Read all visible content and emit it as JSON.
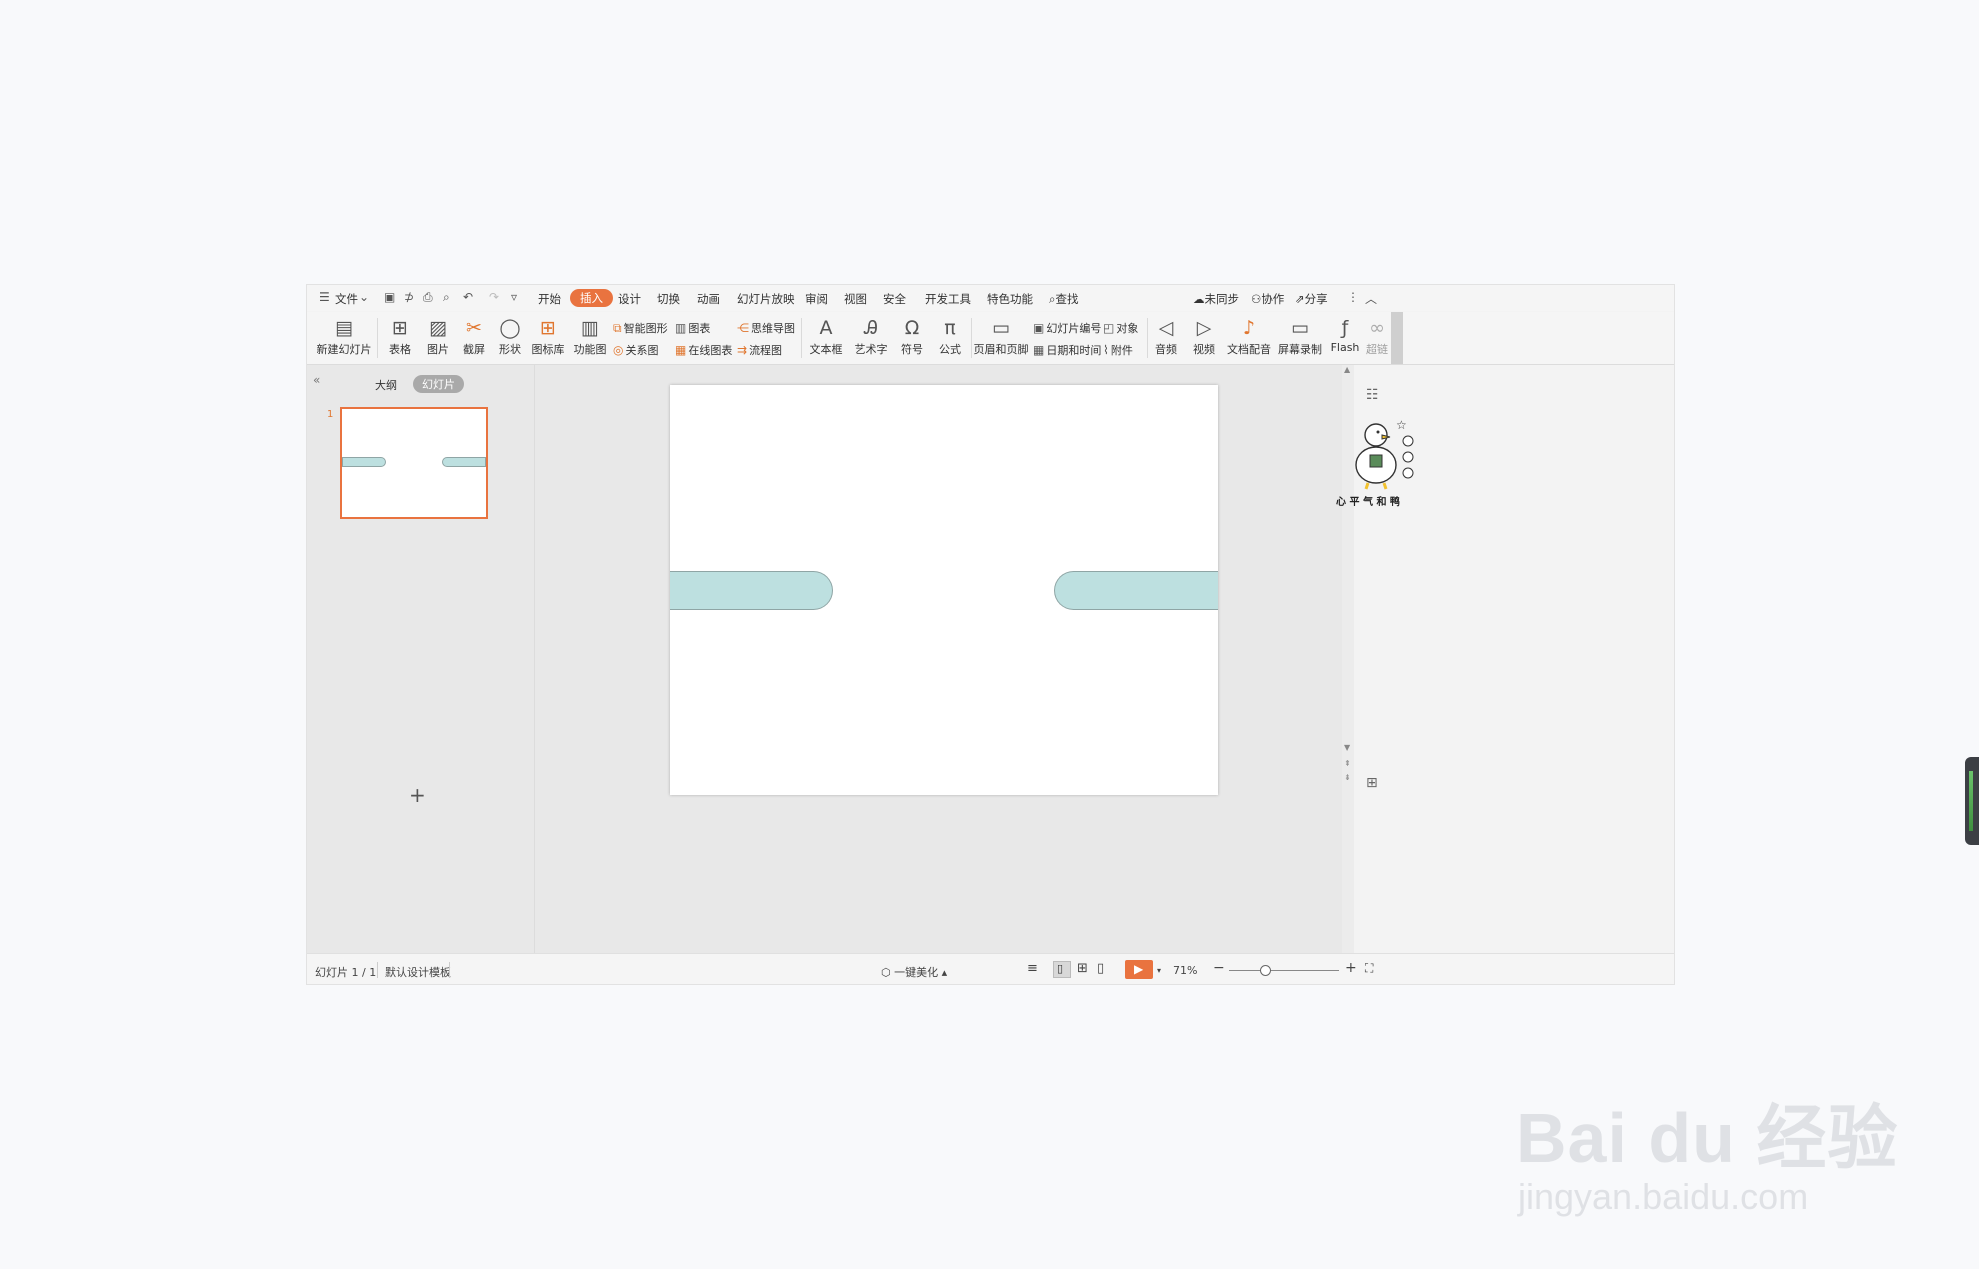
{
  "menu": {
    "file": "文件"
  },
  "tabs": [
    "开始",
    "插入",
    "设计",
    "切换",
    "动画",
    "幻灯片放映",
    "审阅",
    "视图",
    "安全",
    "开发工具",
    "特色功能"
  ],
  "search_label": "查找",
  "top_right": {
    "sync": "未同步",
    "collab": "协作",
    "share": "分享"
  },
  "ribbon": {
    "new_slide": "新建幻灯片",
    "table": "表格",
    "picture": "图片",
    "screenshot": "截屏",
    "shapes": "形状",
    "icon_lib": "图标库",
    "func_chart": "功能图",
    "smart_art": "智能图形",
    "chart": "图表",
    "relation": "关系图",
    "online_chart": "在线图表",
    "mindmap": "思维导图",
    "flowchart": "流程图",
    "textbox": "文本框",
    "wordart": "艺术字",
    "symbol": "符号",
    "formula": "公式",
    "header_footer": "页眉和页脚",
    "slide_number": "幻灯片编号",
    "object": "对象",
    "date_time": "日期和时间",
    "attachment": "附件",
    "audio": "音频",
    "video": "视频",
    "doc_dub": "文档配音",
    "screen_record": "屏幕录制",
    "flash": "Flash",
    "hyperlink": "超链"
  },
  "left_panel": {
    "outline": "大纲",
    "slides": "幻灯片",
    "thumb_number": "1",
    "add": "+"
  },
  "status": {
    "slide_count": "幻灯片 1 / 1",
    "template": "默认设计模板",
    "beautify": "一键美化",
    "zoom": "71%"
  },
  "mascot_caption": "心 平 气 和 鸭",
  "watermark": {
    "brand": "Bai du 经验",
    "url": "jingyan.baidu.com"
  },
  "colors": {
    "accent": "#e9733f",
    "shape_fill": "#bde0e0",
    "shape_border": "#8fa5a5"
  }
}
